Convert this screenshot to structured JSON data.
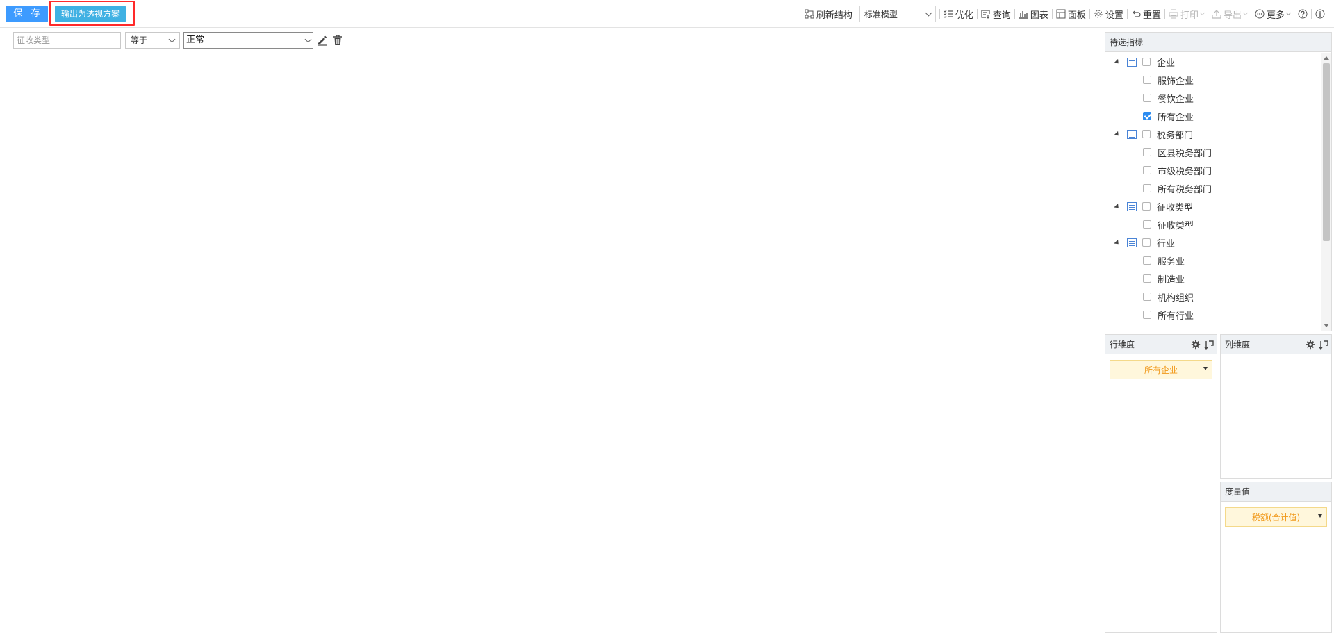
{
  "toolbar": {
    "save_label": "保 存",
    "pivot_label": "输出为透视方案",
    "refresh_label": "刷新结构",
    "model_value": "标准模型",
    "optimize_label": "优化",
    "query_label": "查询",
    "chart_label": "图表",
    "panel_label": "面板",
    "settings_label": "设置",
    "reset_label": "重置",
    "print_label": "打印",
    "export_label": "导出",
    "more_label": "更多"
  },
  "filter": {
    "field_placeholder": "征收类型",
    "operator": "等于",
    "value": "正常"
  },
  "candidates": {
    "title": "待选指标",
    "groups": [
      {
        "label": "企业",
        "children": [
          {
            "label": "服饰企业",
            "checked": false
          },
          {
            "label": "餐饮企业",
            "checked": false
          },
          {
            "label": "所有企业",
            "checked": true
          }
        ]
      },
      {
        "label": "税务部门",
        "children": [
          {
            "label": "区县税务部门",
            "checked": false
          },
          {
            "label": "市级税务部门",
            "checked": false
          },
          {
            "label": "所有税务部门",
            "checked": false
          }
        ]
      },
      {
        "label": "征收类型",
        "children": [
          {
            "label": "征收类型",
            "checked": false
          }
        ]
      },
      {
        "label": "行业",
        "children": [
          {
            "label": "服务业",
            "checked": false
          },
          {
            "label": "制造业",
            "checked": false
          },
          {
            "label": "机构组织",
            "checked": false
          },
          {
            "label": "所有行业",
            "checked": false
          }
        ]
      }
    ]
  },
  "row_dimension": {
    "title": "行维度",
    "items": [
      "所有企业"
    ]
  },
  "col_dimension": {
    "title": "列维度",
    "items": []
  },
  "measures": {
    "title": "度量值",
    "items": [
      "税额(合计值)"
    ]
  },
  "colors": {
    "primary": "#3d9bff",
    "pivot_button": "#3fb1e3",
    "highlight": "#ff2a2a",
    "pill_bg": "#fff7dc",
    "pill_text": "#f19a1c"
  }
}
